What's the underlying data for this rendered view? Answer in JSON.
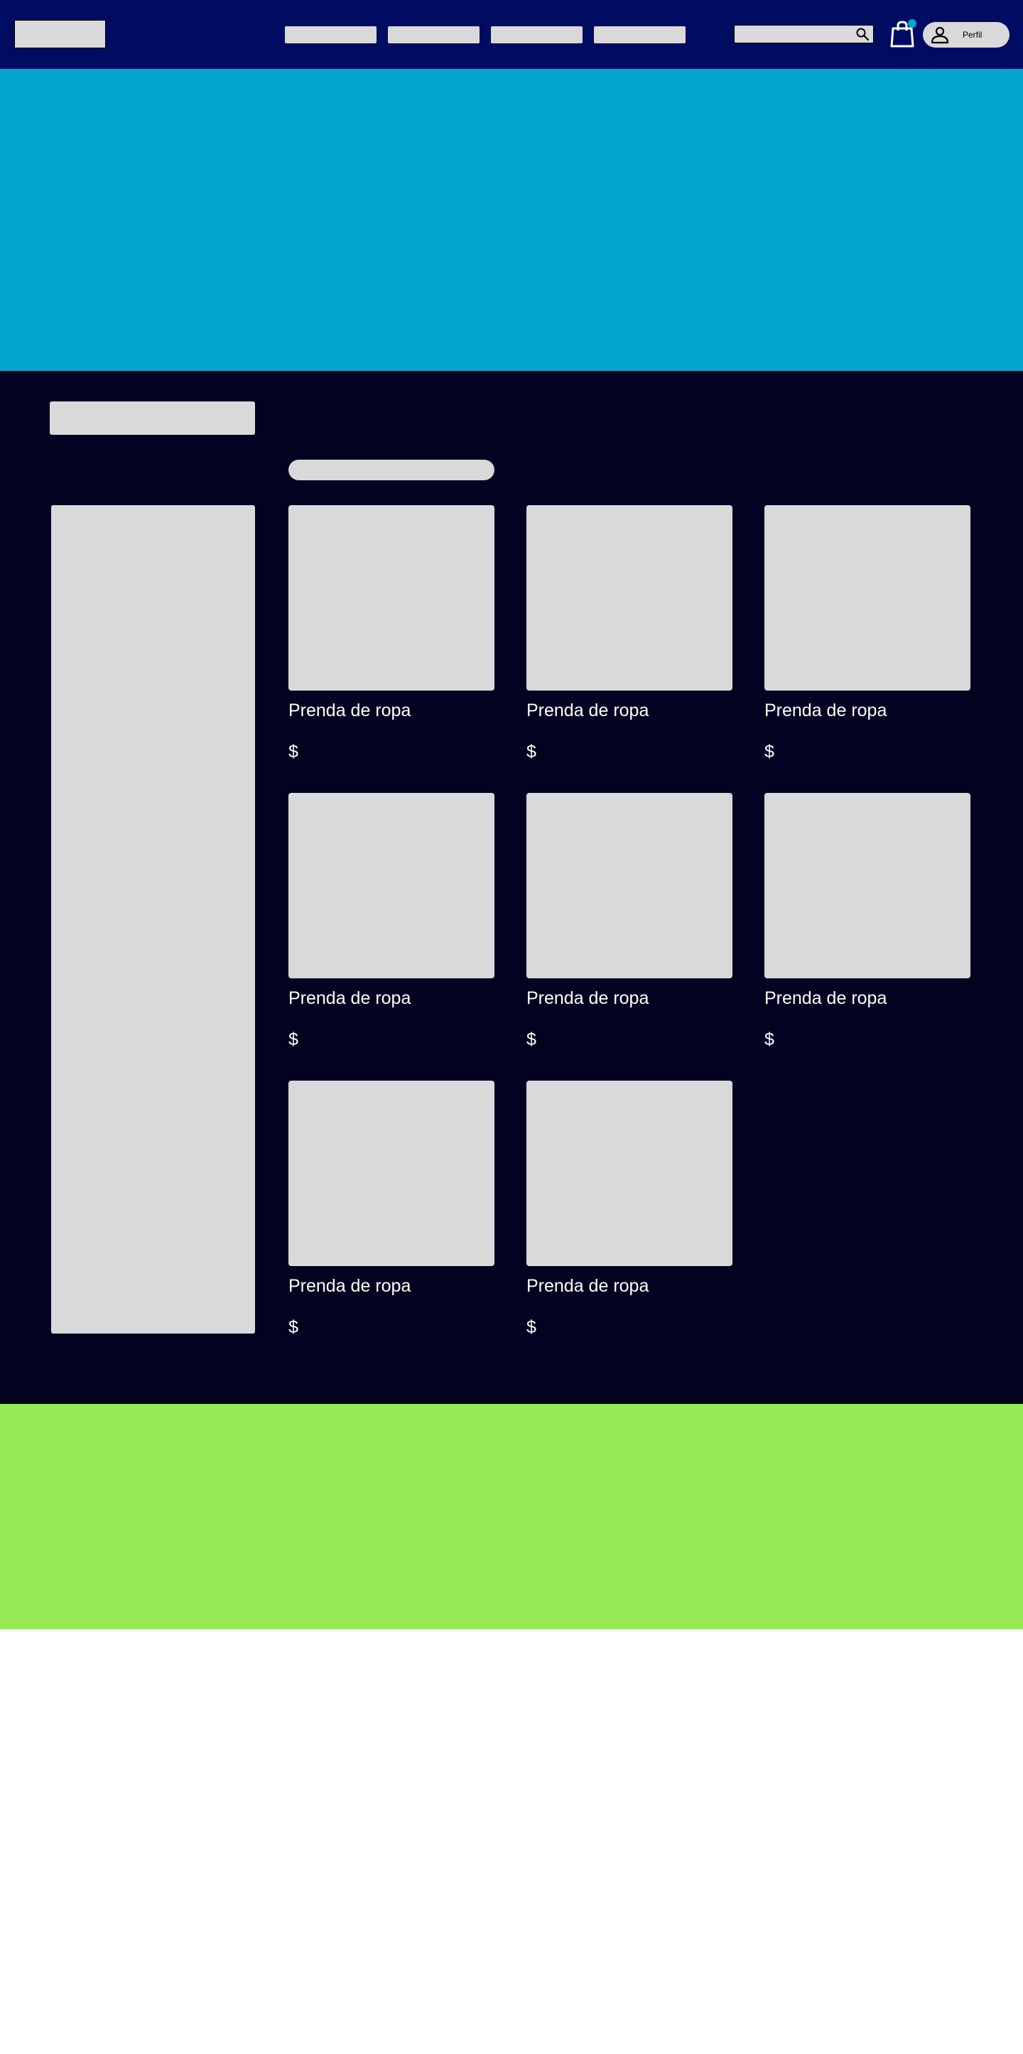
{
  "colors": {
    "header_bg": "#000c61",
    "hero_bg": "#03a6cc",
    "catalog_bg": "#030220",
    "promo_bg": "#95eb54",
    "placeholder": "#d9d9d9",
    "cart_badge": "#03a6cc"
  },
  "header": {
    "profile_label": "Perfil",
    "icons": [
      "search-icon",
      "shopping-bag-icon",
      "user-icon"
    ]
  },
  "products": [
    {
      "name": "Prenda de ropa",
      "price": "$"
    },
    {
      "name": "Prenda de ropa",
      "price": "$"
    },
    {
      "name": "Prenda de ropa",
      "price": "$"
    },
    {
      "name": "Prenda de ropa",
      "price": "$"
    },
    {
      "name": "Prenda de ropa",
      "price": "$"
    },
    {
      "name": "Prenda de ropa",
      "price": "$"
    },
    {
      "name": "Prenda de ropa",
      "price": "$"
    },
    {
      "name": "Prenda de ropa",
      "price": "$"
    }
  ]
}
